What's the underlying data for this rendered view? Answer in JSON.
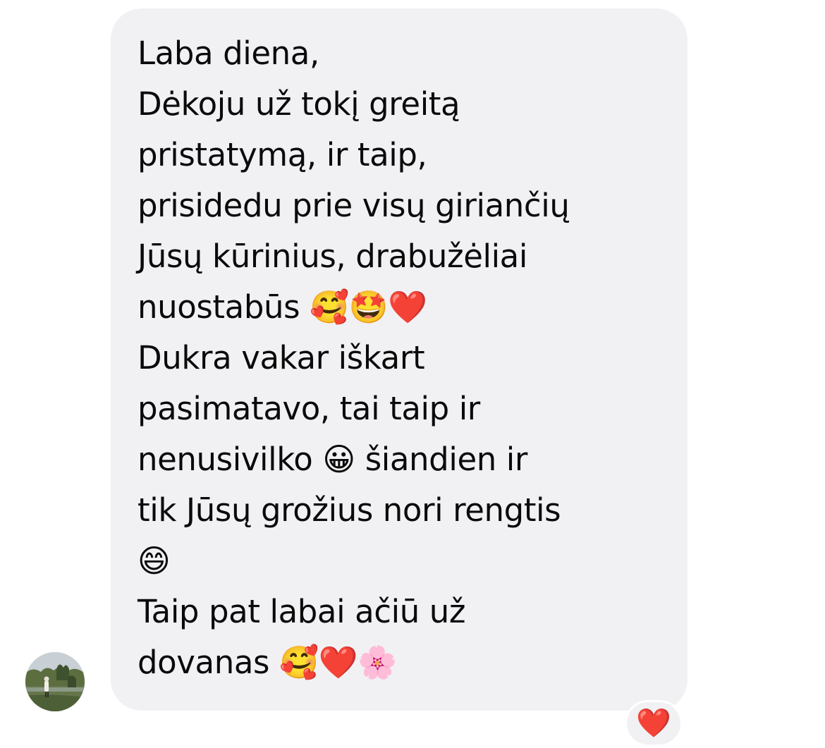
{
  "message": {
    "text": "Laba diena,\nDėkoju už tokį greitą\npristatymą, ir taip,\nprisidedu prie visų giriančių\nJūsų kūrinius, drabužėliai\nnuostabūs 🥰🤩❤️\nDukra vakar iškart\npasimatavo, tai taip ir\nnenusivilko 😀 šiandien ir\ntik Jūsų grožius nori rengtis\n😄\nTaip pat labai ačiū už\ndovanas 🥰❤️🌸",
    "reaction": "❤️"
  },
  "colors": {
    "bubble_bg": "#f1f1f4",
    "text": "#0a0a0a",
    "heart": "#e0192b"
  },
  "icons": {
    "avatar": "profile-photo-avatar",
    "reaction": "red-heart-reaction-icon"
  }
}
